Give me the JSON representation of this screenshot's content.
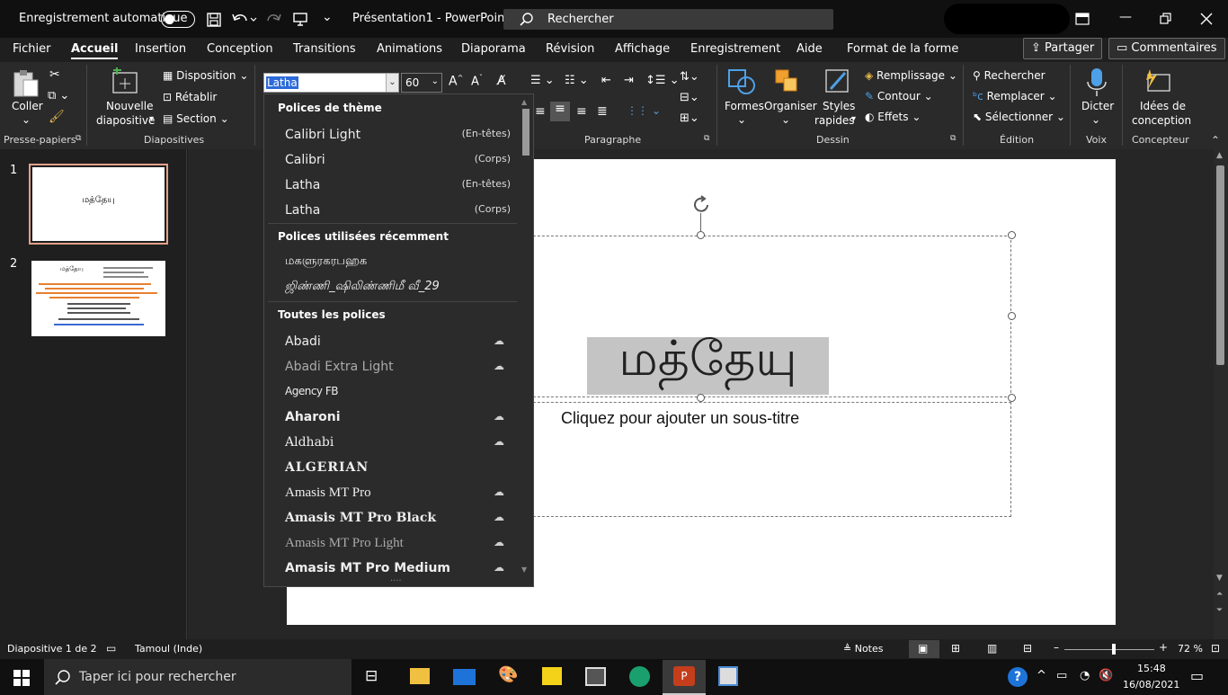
{
  "titlebar": {
    "autosave_label": "Enregistrement automatique",
    "doc_title": "Présentation1  -  PowerPoint",
    "search_label": "Rechercher"
  },
  "menu": {
    "items": [
      "Fichier",
      "Accueil",
      "Insertion",
      "Conception",
      "Transitions",
      "Animations",
      "Diaporama",
      "Révision",
      "Affichage",
      "Enregistrement",
      "Aide",
      "Format de la forme"
    ],
    "active": "Accueil",
    "share": "Partager",
    "comments": "Commentaires"
  },
  "ribbon": {
    "paste": "Coller",
    "new_slide_1": "Nouvelle",
    "new_slide_2": "diapositive",
    "layout": "Disposition",
    "reset": "Rétablir",
    "section": "Section",
    "font_value": "Latha",
    "size_value": "60",
    "shapes": "Formes",
    "arrange": "Organiser",
    "styles_1": "Styles",
    "styles_2": "rapides",
    "fill": "Remplissage",
    "outline": "Contour",
    "effects": "Effets",
    "find": "Rechercher",
    "replace": "Remplacer",
    "select": "Sélectionner",
    "dictate": "Dicter",
    "designer_1": "Idées de",
    "designer_2": "conception",
    "groups": {
      "clipboard": "Presse-papiers",
      "slides": "Diapositives",
      "paragraph": "Paragraphe",
      "drawing": "Dessin",
      "editing": "Édition",
      "voice": "Voix",
      "designer": "Concepteur"
    }
  },
  "font_dropdown": {
    "theme_header": "Polices de thème",
    "theme": [
      {
        "name": "Calibri Light",
        "tag": "(En-têtes)"
      },
      {
        "name": "Calibri",
        "tag": "(Corps)"
      },
      {
        "name": "Latha",
        "tag": "(En-têtes)"
      },
      {
        "name": "Latha",
        "tag": "(Corps)"
      }
    ],
    "recent_header": "Polices utilisées récemment",
    "recent": [
      "மகளுரகரபஹக",
      "ஜிண்ணி_ஷிலிண்ணிமீ வீ_29"
    ],
    "all_header": "Toutes les polices",
    "all": [
      "Abadi",
      "Abadi Extra Light",
      "Agency FB",
      "Aharoni",
      "Aldhabi",
      "ALGERIAN",
      "Amasis MT Pro",
      "Amasis MT Pro Black",
      "Amasis MT Pro Light",
      "Amasis MT Pro Medium"
    ]
  },
  "thumbnails": {
    "n1": "1",
    "n2": "2",
    "slide1_text": "மத்தேயு",
    "slide2_title": "மத்தேயு"
  },
  "slide": {
    "title": "மத்தேயு",
    "subtitle_placeholder": "Cliquez pour ajouter un sous-titre"
  },
  "status": {
    "slide_count": "Diapositive 1 de 2",
    "language": "Tamoul (Inde)",
    "notes": "Notes",
    "zoom": "72 %",
    "zoom_fraction": 0.72
  },
  "taskbar": {
    "search_placeholder": "Taper ici pour rechercher",
    "time": "15:48",
    "date": "16/08/2021"
  },
  "colors": {
    "accent_red": "#c43e1c",
    "selection": "#c4c4c4",
    "thumb_border": "#e3a08a"
  }
}
